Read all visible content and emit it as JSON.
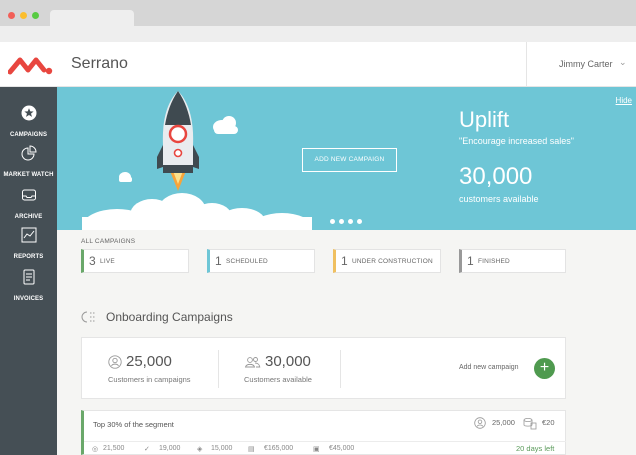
{
  "app": {
    "name": "Serrano",
    "user": "Jimmy Carter"
  },
  "colors": {
    "accent": "#6ec6d6",
    "sidebar": "#454f55",
    "logo": "#e8463f",
    "live": "#6aa86a",
    "scheduled": "#6ec6d6",
    "under_construction": "#f0c060",
    "finished": "#999999",
    "add_button": "#4f9a4f"
  },
  "sidebar": {
    "items": [
      {
        "label": "CAMPAIGNS",
        "icon": "star-icon"
      },
      {
        "label": "MARKET WATCH",
        "icon": "pie-chart-icon"
      },
      {
        "label": "ARCHIVE",
        "icon": "inbox-icon"
      },
      {
        "label": "REPORTS",
        "icon": "line-chart-icon"
      },
      {
        "label": "INVOICES",
        "icon": "invoice-icon"
      }
    ]
  },
  "hero": {
    "hide": "Hide",
    "button": "ADD NEW CAMPAIGN",
    "title": "Uplift",
    "subtitle": "\"Encourage increased sales\"",
    "count": "30,000",
    "count_label": "customers available"
  },
  "campaigns": {
    "heading": "ALL CAMPAIGNS",
    "statuses": [
      {
        "count": "3",
        "label": "LIVE"
      },
      {
        "count": "1",
        "label": "SCHEDULED"
      },
      {
        "count": "1",
        "label": "UNDER CONSTRUCTION"
      },
      {
        "count": "1",
        "label": "FINISHED"
      }
    ]
  },
  "onboarding": {
    "title": "Onboarding Campaigns",
    "stats": [
      {
        "value": "25,000",
        "label": "Customers in campaigns"
      },
      {
        "value": "30,000",
        "label": "Customers available"
      }
    ],
    "add_label": "Add new campaign"
  },
  "segment": {
    "title": "Top 30% of the segment",
    "customers": "25,000",
    "price": "€20",
    "metrics": [
      "21,500",
      "19,000",
      "15,000",
      "€165,000",
      "€45,000"
    ],
    "days_left": "20 days left"
  }
}
